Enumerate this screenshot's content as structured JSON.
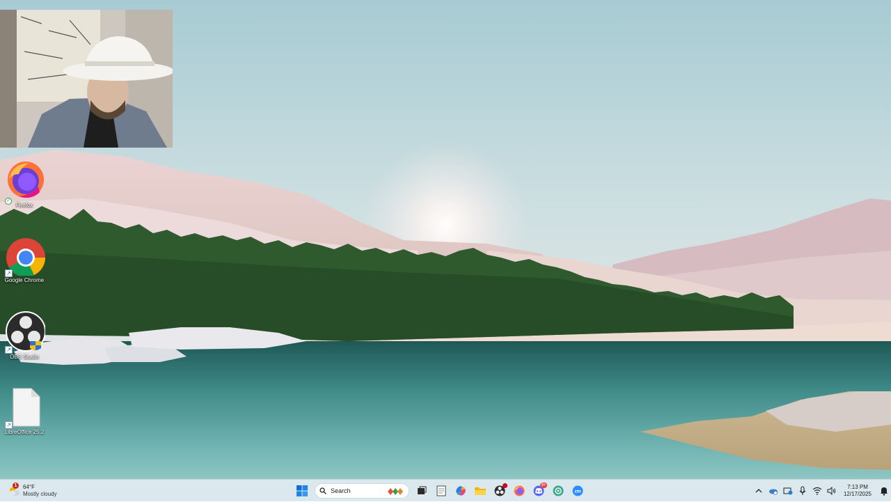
{
  "desktop": {
    "icons": [
      {
        "label": "Firefox",
        "icon": "firefox-icon",
        "badge": "sync-status"
      },
      {
        "label": "Google Chrome",
        "icon": "chrome-icon",
        "badge": "shortcut-arrow"
      },
      {
        "label": "OBS Studio",
        "icon": "obs-icon",
        "badge": "shortcut-arrow"
      },
      {
        "label": "LibreOffice 25.2",
        "icon": "document-icon",
        "badge": "shortcut-arrow"
      }
    ]
  },
  "taskbar": {
    "weather": {
      "temperature": "64°F",
      "condition": "Mostly cloudy",
      "badge": "1"
    },
    "search": {
      "placeholder": "Search"
    },
    "pinned": [
      "start-icon",
      "search-icon",
      "task-view-icon",
      "notepad-icon",
      "copilot-icon",
      "file-explorer-icon",
      "obs-icon",
      "firefox-icon",
      "discord-icon",
      "chatgpt-icon",
      "zoom-icon"
    ],
    "discord_badge": "9+",
    "tray": [
      "chevron-up-icon",
      "onedrive-icon",
      "sync-icon",
      "microphone-icon",
      "wifi-icon",
      "volume-icon"
    ],
    "clock": {
      "time": "7:13 PM",
      "date": "12/17/2025"
    }
  },
  "colors": {
    "sky": "#aeced6",
    "water": "#3f8a8a",
    "forest": "#2f5a2e",
    "taskbar": "#dae8ee"
  }
}
